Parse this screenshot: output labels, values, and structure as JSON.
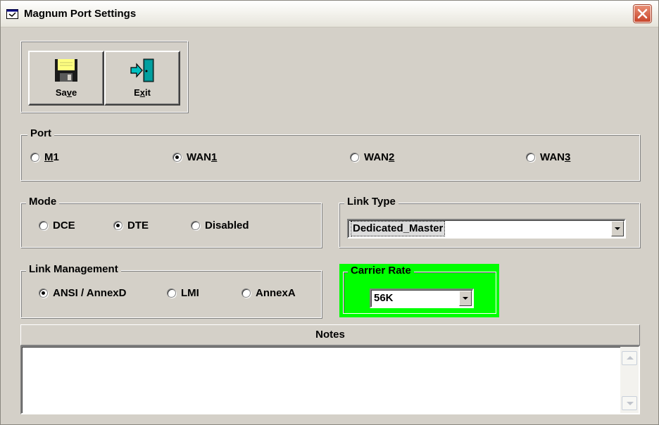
{
  "window": {
    "title": "Magnum Port Settings",
    "icon": "app-window-icon",
    "close_icon": "close-icon",
    "close_color": "#d9532f"
  },
  "toolbar": {
    "save": {
      "pre": "Sa",
      "mnemonic": "v",
      "post": "e",
      "icon": "floppy-disk-icon"
    },
    "exit": {
      "pre": "E",
      "mnemonic": "x",
      "post": "it",
      "icon": "exit-door-icon"
    }
  },
  "port": {
    "legend": "Port",
    "options": [
      {
        "pre": "",
        "mnemonic": "M",
        "post": "1",
        "selected": false
      },
      {
        "pre": "WAN",
        "mnemonic": "1",
        "post": "",
        "selected": true
      },
      {
        "pre": "WAN",
        "mnemonic": "2",
        "post": "",
        "selected": false
      },
      {
        "pre": "WAN",
        "mnemonic": "3",
        "post": "",
        "selected": false
      }
    ]
  },
  "mode": {
    "legend": "Mode",
    "options": [
      {
        "label": "DCE",
        "selected": false
      },
      {
        "label": "DTE",
        "selected": true
      },
      {
        "label": "Disabled",
        "selected": false
      }
    ]
  },
  "link_type": {
    "legend": "Link Type",
    "value": "Dedicated_Master"
  },
  "link_management": {
    "legend": "Link Management",
    "options": [
      {
        "label": "ANSI / AnnexD",
        "selected": true
      },
      {
        "label": "LMI",
        "selected": false
      },
      {
        "label": "AnnexA",
        "selected": false
      }
    ]
  },
  "carrier_rate": {
    "legend": "Carrier Rate",
    "value": "56K",
    "highlight_color": "#00ff00"
  },
  "notes": {
    "header": "Notes",
    "value": ""
  }
}
